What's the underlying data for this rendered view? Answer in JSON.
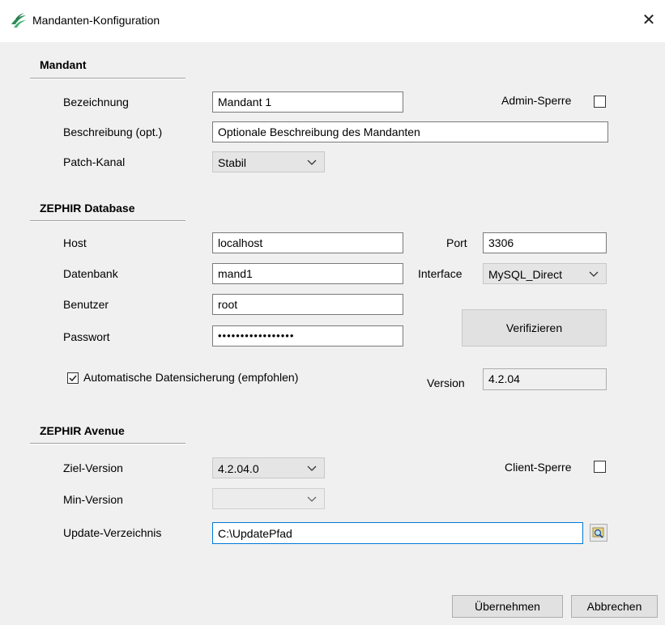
{
  "window": {
    "title": "Mandanten-Konfiguration",
    "close_glyph": "✕"
  },
  "mandant": {
    "heading": "Mandant",
    "bezeichnung_label": "Bezeichnung",
    "bezeichnung_value": "Mandant 1",
    "beschreibung_label": "Beschreibung (opt.)",
    "beschreibung_value": "Optionale Beschreibung des Mandanten",
    "patch_label": "Patch-Kanal",
    "patch_value": "Stabil",
    "admin_sperre_label": "Admin-Sperre",
    "admin_sperre_checked": false
  },
  "database": {
    "heading": "ZEPHIR Database",
    "host_label": "Host",
    "host_value": "localhost",
    "port_label": "Port",
    "port_value": "3306",
    "datenbank_label": "Datenbank",
    "datenbank_value": "mand1",
    "interface_label": "Interface",
    "interface_value": "MySQL_Direct",
    "benutzer_label": "Benutzer",
    "benutzer_value": "root",
    "passwort_label": "Passwort",
    "passwort_value": "•••••••••••••••••",
    "verify_label": "Verifizieren",
    "backup_label": "Automatische Datensicherung (empfohlen)",
    "backup_checked": true,
    "version_label": "Version",
    "version_value": "4.2.04"
  },
  "avenue": {
    "heading": "ZEPHIR Avenue",
    "ziel_label": "Ziel-Version",
    "ziel_value": "4.2.04.0",
    "min_label": "Min-Version",
    "min_value": "",
    "update_label": "Update-Verzeichnis",
    "update_value": "C:\\UpdatePfad",
    "client_sperre_label": "Client-Sperre",
    "client_sperre_checked": false
  },
  "footer": {
    "apply_label": "Übernehmen",
    "cancel_label": "Abbrechen"
  },
  "icons": {
    "app": "zephir-logo-icon",
    "browse": "folder-search-icon",
    "chevron": "chevron-down-icon"
  }
}
